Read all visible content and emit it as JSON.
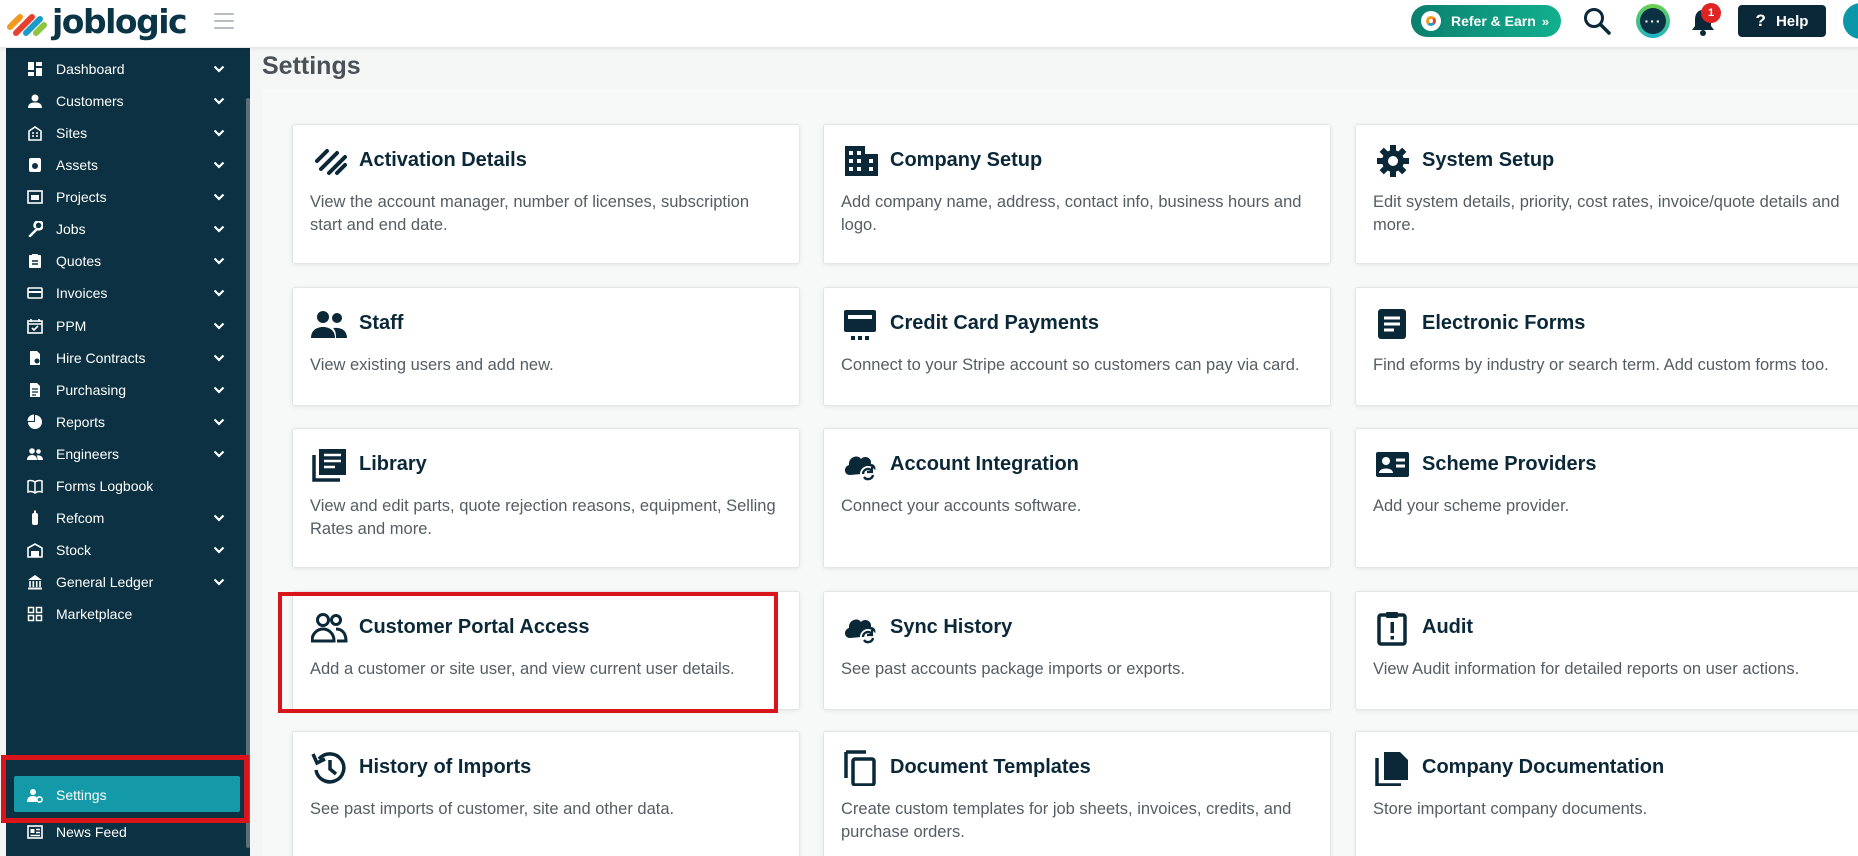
{
  "app": {
    "name": "joblogic"
  },
  "topbar": {
    "refer_label": "Refer & Earn",
    "notification_count": "1",
    "help_label": "Help"
  },
  "sidebar": {
    "items": [
      {
        "label": "Dashboard",
        "icon": "dashboard-icon",
        "has_submenu": true
      },
      {
        "label": "Customers",
        "icon": "person-icon",
        "has_submenu": true
      },
      {
        "label": "Sites",
        "icon": "building-icon",
        "has_submenu": true
      },
      {
        "label": "Assets",
        "icon": "asset-icon",
        "has_submenu": true
      },
      {
        "label": "Projects",
        "icon": "project-icon",
        "has_submenu": true
      },
      {
        "label": "Jobs",
        "icon": "wrench-icon",
        "has_submenu": true
      },
      {
        "label": "Quotes",
        "icon": "clipboard-icon",
        "has_submenu": true
      },
      {
        "label": "Invoices",
        "icon": "invoice-icon",
        "has_submenu": true
      },
      {
        "label": "PPM",
        "icon": "calendar-icon",
        "has_submenu": true
      },
      {
        "label": "Hire Contracts",
        "icon": "contract-icon",
        "has_submenu": true
      },
      {
        "label": "Purchasing",
        "icon": "document-icon",
        "has_submenu": true
      },
      {
        "label": "Reports",
        "icon": "pie-chart-icon",
        "has_submenu": true
      },
      {
        "label": "Engineers",
        "icon": "people-icon",
        "has_submenu": true
      },
      {
        "label": "Forms Logbook",
        "icon": "book-icon",
        "has_submenu": false
      },
      {
        "label": "Refcom",
        "icon": "cylinder-icon",
        "has_submenu": true
      },
      {
        "label": "Stock",
        "icon": "stock-icon",
        "has_submenu": true
      },
      {
        "label": "General Ledger",
        "icon": "bank-icon",
        "has_submenu": true
      },
      {
        "label": "Marketplace",
        "icon": "grid-icon",
        "has_submenu": false
      }
    ],
    "active": {
      "label": "Settings",
      "icon": "user-settings-icon"
    },
    "after": {
      "label": "News Feed",
      "icon": "news-icon"
    }
  },
  "page": {
    "title": "Settings"
  },
  "cards": [
    {
      "title": "Activation Details",
      "icon": "activation-icon",
      "description": "View the account manager, number of licenses, subscription start and end date."
    },
    {
      "title": "Company Setup",
      "icon": "office-building-icon",
      "description": "Add company name, address, contact info, business hours and logo."
    },
    {
      "title": "System Setup",
      "icon": "gear-icon",
      "description": "Edit system details, priority, cost rates, invoice/quote details and more."
    },
    {
      "title": "Staff",
      "icon": "staff-icon",
      "description": "View existing users and add new."
    },
    {
      "title": "Credit Card Payments",
      "icon": "credit-card-icon",
      "description": "Connect to your Stripe account so customers can pay via card."
    },
    {
      "title": "Electronic Forms",
      "icon": "form-icon",
      "description": "Find eforms by industry or search term. Add custom forms too."
    },
    {
      "title": "Library",
      "icon": "library-icon",
      "description": "View and edit parts, quote rejection reasons, equipment, Selling Rates and more."
    },
    {
      "title": "Account Integration",
      "icon": "cloud-sync-icon",
      "description": "Connect your accounts software."
    },
    {
      "title": "Scheme Providers",
      "icon": "id-card-icon",
      "description": "Add your scheme provider."
    },
    {
      "title": "Customer Portal Access",
      "icon": "portal-users-icon",
      "description": "Add a customer or site user, and view current user details."
    },
    {
      "title": "Sync History",
      "icon": "cloud-sync-icon",
      "description": "See past accounts package imports or exports."
    },
    {
      "title": "Audit",
      "icon": "audit-clipboard-icon",
      "description": "View Audit information for detailed reports on user actions."
    },
    {
      "title": "History of Imports",
      "icon": "history-icon",
      "description": "See past imports of customer, site and other data."
    },
    {
      "title": "Document Templates",
      "icon": "copy-icon",
      "description": "Create custom templates for job sheets, invoices, credits, and purchase orders."
    },
    {
      "title": "Company Documentation",
      "icon": "documents-icon",
      "description": "Store important company documents."
    }
  ],
  "colors": {
    "sidebar": "#0b3142",
    "active_item": "#1499a8",
    "highlight": "#d9141b",
    "title_text": "#0b2838"
  }
}
